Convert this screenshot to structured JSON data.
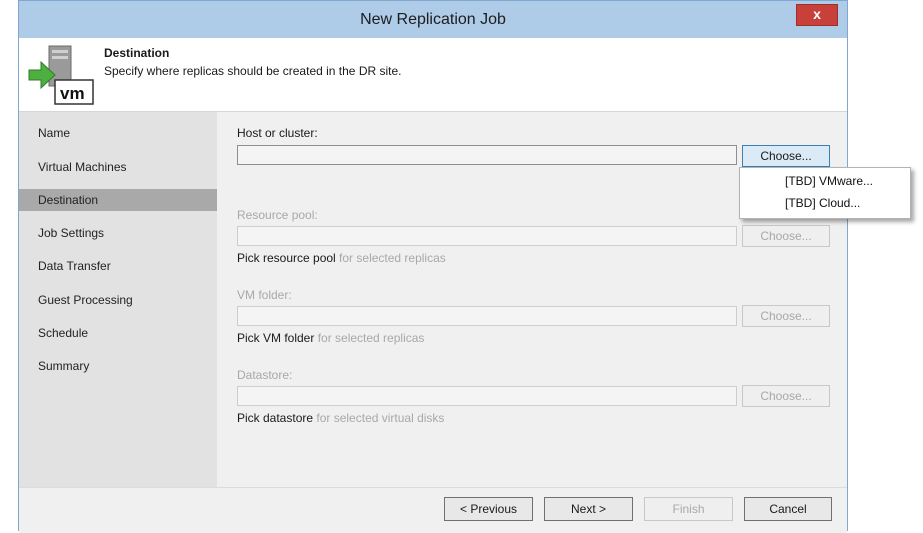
{
  "window": {
    "title": "New Replication Job",
    "close_glyph": "x"
  },
  "header": {
    "title": "Destination",
    "description": "Specify where replicas should be created in the DR site.",
    "icon_label": "vm"
  },
  "sidebar": {
    "items": [
      {
        "label": "Name"
      },
      {
        "label": "Virtual Machines"
      },
      {
        "label": "Destination",
        "selected": true
      },
      {
        "label": "Job Settings"
      },
      {
        "label": "Data Transfer"
      },
      {
        "label": "Guest Processing"
      },
      {
        "label": "Schedule"
      },
      {
        "label": "Summary"
      }
    ]
  },
  "form": {
    "host": {
      "label": "Host or cluster:",
      "value": "",
      "button": "Choose..."
    },
    "resource_pool": {
      "label": "Resource pool:",
      "value": "",
      "button": "Choose...",
      "pick_strong": "Pick resource pool",
      "pick_weak": " for selected replicas"
    },
    "vm_folder": {
      "label": "VM folder:",
      "value": "",
      "button": "Choose...",
      "pick_strong": "Pick VM folder",
      "pick_weak": " for selected replicas"
    },
    "datastore": {
      "label": "Datastore:",
      "value": "",
      "button": "Choose...",
      "pick_strong": "Pick datastore",
      "pick_weak": " for selected virtual disks"
    }
  },
  "dropdown_menu": {
    "items": [
      {
        "label": "[TBD] VMware..."
      },
      {
        "label": "[TBD] Cloud..."
      }
    ]
  },
  "footer": {
    "previous": "< Previous",
    "next": "Next >",
    "finish": "Finish",
    "cancel": "Cancel"
  },
  "colors": {
    "titlebar": "#aecbe8",
    "close_button": "#c7403a",
    "sidebar": "#e2e2e2",
    "sidebar_selected": "#a9a9a9",
    "icon_arrow": "#4caf3f"
  }
}
